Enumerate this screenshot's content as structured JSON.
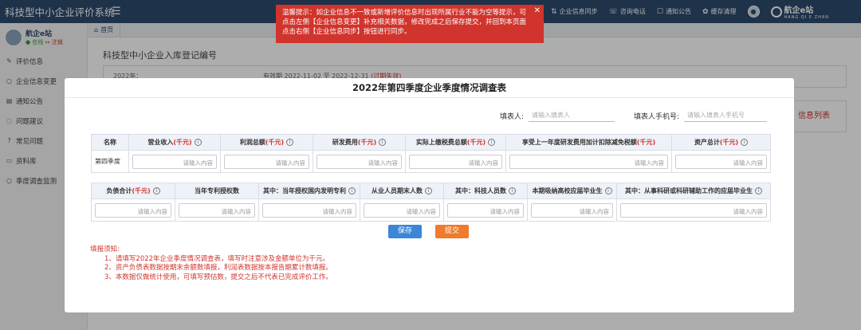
{
  "app": {
    "title": "科技型中小企业评价系统"
  },
  "topbar": {
    "actions": [
      {
        "icon": "sync-icon",
        "label": "企业信息同步"
      },
      {
        "icon": "phone-icon",
        "label": "咨询电话"
      },
      {
        "icon": "bell-icon",
        "label": "通知公告"
      },
      {
        "icon": "clear-cache-icon",
        "label": "缓存清理"
      }
    ],
    "logo": {
      "name": "航企e站",
      "sub": "HANG QI E ZHAN"
    }
  },
  "warning": {
    "text": "温馨提示：如企业信息不一致或新增评价信息时出现所属行业不能为空等提示，可点击左侧【企业信息变更】补充相关数据，修改完成之后保存提交，并回到本页面点击右侧【企业信息同步】按钮进行同步。"
  },
  "sidebar": {
    "brand": "航企e站",
    "status_online": "● 在线",
    "status_logout": "↦ 注销",
    "items": [
      {
        "label": "评价信息",
        "icon": "edit-icon"
      },
      {
        "label": "企业信息变更",
        "icon": "circle-icon"
      },
      {
        "label": "通知公告",
        "icon": "notice-icon"
      },
      {
        "label": "问题建议",
        "icon": "chat-icon"
      },
      {
        "label": "常见问题",
        "icon": "question-icon"
      },
      {
        "label": "资料库",
        "icon": "folder-icon"
      },
      {
        "label": "季度调查监测",
        "icon": "circle-icon"
      }
    ]
  },
  "breadcrumb": {
    "home": "首页"
  },
  "page": {
    "title": "科技型中小企业入库登记编号",
    "period_year": "2022年：",
    "period_dates": "有效期 2022-11-02 至 2022-12-31",
    "period_status": "(过期失效)",
    "side_link": "信息列表"
  },
  "modal": {
    "title": "2022年第四季度企业季度情况调查表",
    "filler_label": "填表人:",
    "filler_placeholder": "请输入填表人",
    "phone_label": "填表人手机号:",
    "phone_placeholder": "请输入填表人手机号",
    "unit": "(千元)",
    "input_placeholder": "请输入内容",
    "row_label": "第四季度",
    "table1_headers": [
      "名称",
      "营业收入",
      "利润总额",
      "研发费用",
      "实际上缴税费总额",
      "享受上一年度研发费用加计扣除减免税额",
      "资产总计"
    ],
    "table2_headers": [
      "负债合计",
      "当年专利授权数",
      "其中：当年授权国内发明专利",
      "从业人员期末人数",
      "其中：科技人员数",
      "本期吸纳高校应届毕业生",
      "其中：从事科研或科研辅助工作的应届毕业生"
    ],
    "save_label": "保存",
    "submit_label": "提交",
    "notes_title": "填报须知:",
    "notes": [
      "1、请填写2022年企业季度情况调查表，填写时注意涉及金额单位为千元。",
      "2、资产负债表数据按期末余额数填报，利润表数据按本报告期累计数填报。",
      "3、本数据仅做统计使用，可填写预估数，提交之后不代表已完成评价工作。"
    ]
  }
}
